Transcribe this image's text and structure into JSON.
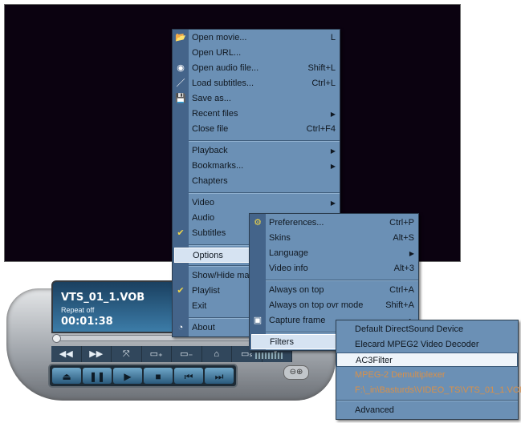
{
  "player": {
    "filename": "VTS_01_1.VOB",
    "repeat": "Repeat off",
    "time": "00:01:38",
    "toolbar": [
      "◀◀",
      "▶▶",
      "⤧",
      "▭₊",
      "▭₋",
      "⌂",
      "▭ₛ",
      "↖"
    ],
    "transport": [
      "⏏",
      "❚❚",
      "▶",
      "■",
      "⏮",
      "⏭"
    ],
    "volume": "⊖⊕"
  },
  "main_menu": {
    "items": [
      {
        "label": "Open movie...",
        "shortcut": "L",
        "icon": "📂"
      },
      {
        "label": "Open URL...",
        "shortcut": ""
      },
      {
        "label": "Open audio file...",
        "shortcut": "Shift+L",
        "icon": "◉"
      },
      {
        "label": "Load subtitles...",
        "shortcut": "Ctrl+L",
        "icon": "／"
      },
      {
        "label": "Save as...",
        "shortcut": "",
        "icon": "💾"
      },
      {
        "label": "Recent files",
        "shortcut": "▶"
      },
      {
        "label": "Close file",
        "shortcut": "Ctrl+F4"
      },
      {
        "label": "Playback",
        "shortcut": "▶"
      },
      {
        "label": "Bookmarks...",
        "shortcut": "▶"
      },
      {
        "label": "Chapters",
        "shortcut": ""
      },
      {
        "label": "Video",
        "shortcut": "▶"
      },
      {
        "label": "Audio",
        "shortcut": ""
      },
      {
        "label": "Subtitles",
        "shortcut": "",
        "icon": "✔"
      },
      {
        "label": "Options",
        "shortcut": ""
      },
      {
        "label": "Show/Hide mai",
        "shortcut": ""
      },
      {
        "label": "Playlist",
        "shortcut": "",
        "icon": "✔"
      },
      {
        "label": "Exit",
        "shortcut": ""
      },
      {
        "label": "About",
        "shortcut": "",
        "icon": "◔"
      }
    ]
  },
  "options_menu": {
    "items": [
      {
        "label": "Preferences...",
        "shortcut": "Ctrl+P",
        "icon": "⚙"
      },
      {
        "label": "Skins",
        "shortcut": "Alt+S"
      },
      {
        "label": "Language",
        "shortcut": "▶"
      },
      {
        "label": "Video info",
        "shortcut": "Alt+3"
      },
      {
        "label": "Always on top",
        "shortcut": "Ctrl+A"
      },
      {
        "label": "Always on top ovr mode",
        "shortcut": "Shift+A"
      },
      {
        "label": "Capture frame",
        "shortcut": "▶",
        "icon": "▣"
      },
      {
        "label": "Filters",
        "shortcut": ""
      }
    ]
  },
  "filters_menu": {
    "items": [
      {
        "label": "Default DirectSound Device"
      },
      {
        "label": "Elecard MPEG2 Video Decoder"
      },
      {
        "label": "AC3Filter"
      },
      {
        "label": "MPEG-2 Demultiplexer"
      },
      {
        "label": "F:\\_in\\Basturds\\VIDEO_TS\\VTS_01_1.VOB"
      },
      {
        "label": "Advanced"
      }
    ]
  }
}
